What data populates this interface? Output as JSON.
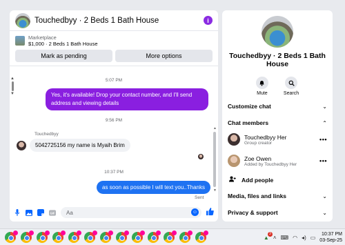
{
  "chat": {
    "title": "Touchedbyy · 2 Beds 1 Bath House",
    "listing_label": "Marketplace",
    "listing_price_title": "$1,000 · 2 Beds 1 Bath House",
    "mark_pending_label": "Mark as pending",
    "more_options_label": "More options",
    "messages": {
      "time1": "5:07 PM",
      "out1": "Yes, it's available! Drop your contact number, and I'll send address and viewing details",
      "time2": "9:56 PM",
      "sender": "Touchedbyy",
      "in1": "5042725156 my name is Myaih Brim",
      "time3": "10:37 PM",
      "out2": "as soon as possible I will text you..Thanks",
      "sent": "Sent"
    },
    "composer_placeholder": "Aa",
    "icons": [
      "microphone-icon",
      "photo-icon",
      "sticker-icon",
      "gif-icon",
      "emoji-icon",
      "like-icon"
    ]
  },
  "info": {
    "title": "Touchedbyy · 2 Beds 1 Bath House",
    "mute_label": "Mute",
    "search_label": "Search",
    "customize_chat": "Customize chat",
    "chat_members": "Chat members",
    "members": [
      {
        "name": "Touchedbyy Her",
        "sub": "Group creator"
      },
      {
        "name": "Zoe Owen",
        "sub": "Added by Touchedbyy Her"
      }
    ],
    "add_people": "Add people",
    "media_files_links": "Media, files and links",
    "privacy_support": "Privacy & support"
  },
  "taskbar": {
    "time": "10:37 PM",
    "date": "03-Sep-25",
    "app_count": 13,
    "notification_badge": "3"
  },
  "colors": {
    "outgoing_purple": "#8a1fe0",
    "outgoing_blue": "#1e72f2",
    "accent": "#0866ff"
  }
}
